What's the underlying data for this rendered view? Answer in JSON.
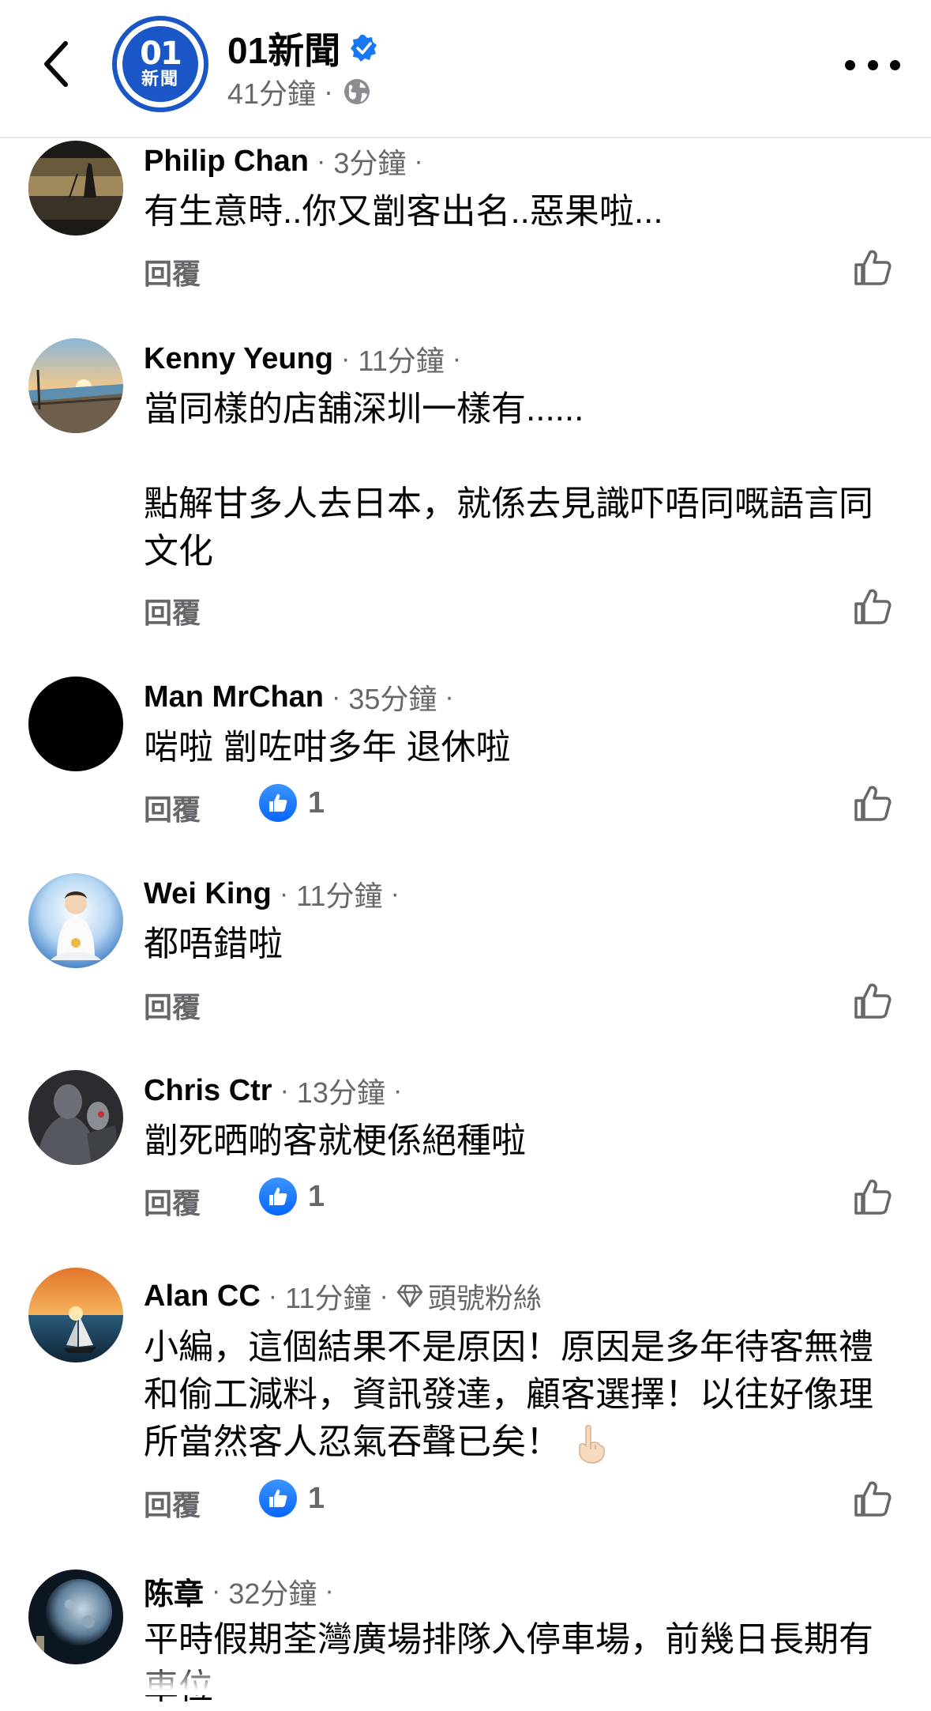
{
  "header": {
    "page_name": "01新聞",
    "logo_number": "01",
    "logo_text": "新聞",
    "time": "41分鐘",
    "separator": "·"
  },
  "reply_label": "回覆",
  "separator": "·",
  "comments": [
    {
      "name": "Philip Chan",
      "time": "3分鐘",
      "text": "有生意時..你又劏客出名..惡果啦...",
      "likes": null,
      "avatar": "sunset-silhouette"
    },
    {
      "name": "Kenny Yeung",
      "time": "11分鐘",
      "text": "當同樣的店舖深圳一樣有......",
      "text2": "點解甘多人去日本，就係去見識吓唔同嘅語言同文化",
      "likes": null,
      "avatar": "waterfront-promenade"
    },
    {
      "name": "Man MrChan",
      "time": "35分鐘",
      "text": "啱啦 劏咗咁多年 退休啦",
      "likes": "1",
      "avatar": "black"
    },
    {
      "name": "Wei King",
      "time": "11分鐘",
      "text": "都唔錯啦",
      "likes": null,
      "avatar": "buddha-figure"
    },
    {
      "name": "Chris Ctr",
      "time": "13分鐘",
      "text": "劏死晒啲客就梗係絕種啦",
      "likes": "1",
      "avatar": "robot-figure"
    },
    {
      "name": "Alan CC",
      "time": "11分鐘",
      "badge": "頭號粉絲",
      "text": "小編，這個結果不是原因！原因是多年待客無禮和偷工減料，資訊發達，顧客選擇！以往好像理所當然客人忍氣吞聲已矣！",
      "emoji": "index-pointing-up",
      "likes": "1",
      "avatar": "sailboat-sunset"
    },
    {
      "name": "陈章",
      "time": "32分鐘",
      "text": "平時假期荃灣廣場排隊入停車場，前幾日長期有車位",
      "likes": null,
      "avatar": "moon-night"
    }
  ],
  "colors": {
    "brand_blue": "#1a56c5",
    "like_blue": "#0866ff",
    "secondary_text": "#65676b",
    "primary_text": "#050505"
  }
}
